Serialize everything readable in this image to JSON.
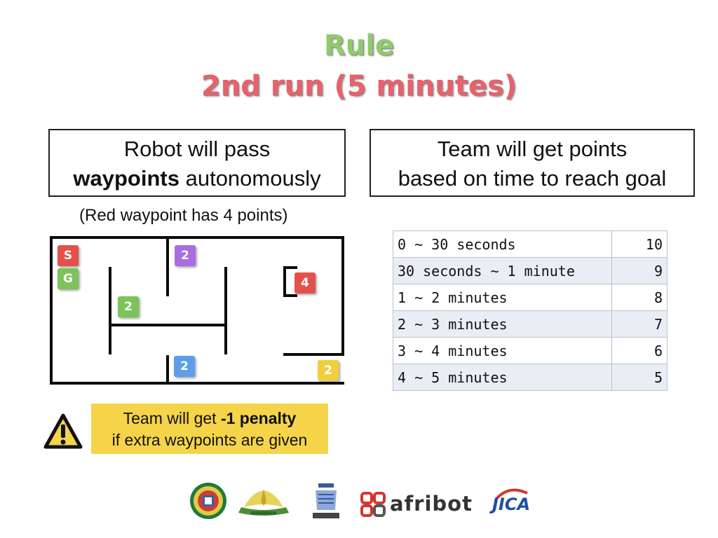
{
  "title": {
    "line1": "Rule",
    "line2": "2nd run (5 minutes)"
  },
  "left_box": {
    "line1": "Robot will pass",
    "line2_bold": "waypoints",
    "line2_rest": " autonomously"
  },
  "right_box": {
    "line1": "Team will get points",
    "line2": "based on time to reach goal"
  },
  "note": "(Red waypoint has 4 points)",
  "maze": {
    "start_label": "S",
    "goal_label": "G",
    "waypoints": [
      {
        "label": "2",
        "color": "#a86ee0"
      },
      {
        "label": "2",
        "color": "#7cc35a"
      },
      {
        "label": "4",
        "color": "#e4514b"
      },
      {
        "label": "2",
        "color": "#5d9ee8"
      },
      {
        "label": "2",
        "color": "#f0cf3c"
      }
    ],
    "start_color": "#e4514b",
    "goal_color": "#7cc35a"
  },
  "points_table": [
    {
      "range": "0 ~ 30 seconds",
      "points": "10"
    },
    {
      "range": "30 seconds ~ 1 minute",
      "points": "9"
    },
    {
      "range": "1 ~ 2 minutes",
      "points": "8"
    },
    {
      "range": "2 ~ 3 minutes",
      "points": "7"
    },
    {
      "range": "3 ~ 4 minutes",
      "points": "6"
    },
    {
      "range": "4 ~ 5 minutes",
      "points": "5"
    }
  ],
  "penalty": {
    "line1_pre": "Team will get ",
    "line1_bold": "-1 penalty",
    "line2": "if extra waypoints are given"
  },
  "logos": {
    "afribot_text": "afribot",
    "jica_text": "JICA"
  },
  "colors": {
    "title_green": "#8fcb6b",
    "title_red": "#e8616b",
    "penalty_bg": "#f5d44a"
  }
}
